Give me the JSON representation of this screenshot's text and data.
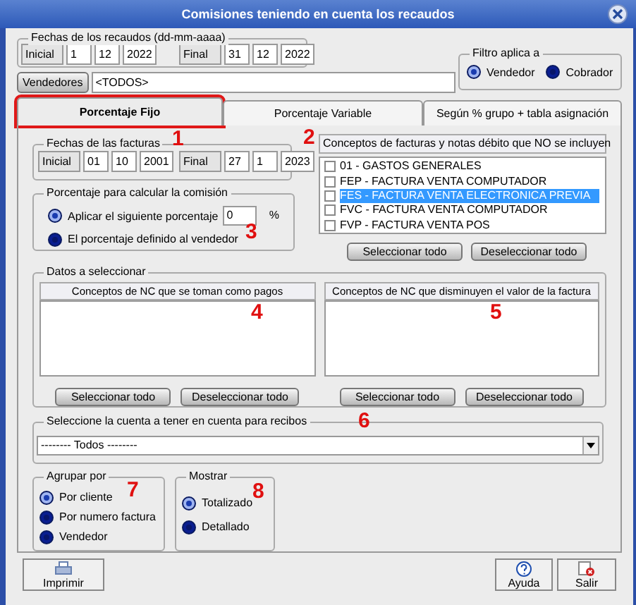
{
  "window": {
    "title": "Comisiones teniendo en cuenta los recaudos"
  },
  "fechas_recaudos": {
    "legend": "Fechas de los recaudos (dd-mm-aaaa)",
    "inicial": {
      "label": "Inicial",
      "day": "1",
      "month": "12",
      "year": "2022"
    },
    "final": {
      "label": "Final",
      "day": "31",
      "month": "12",
      "year": "2022"
    }
  },
  "vendedores": {
    "button": "Vendedores",
    "value": "<TODOS>"
  },
  "filtro": {
    "legend": "Filtro aplica a",
    "options": [
      {
        "label": "Vendedor",
        "selected": true
      },
      {
        "label": "Cobrador",
        "selected": false
      }
    ]
  },
  "tabs": [
    {
      "label": "Porcentaje Fijo",
      "selected": true,
      "highlighted": true
    },
    {
      "label": "Porcentaje Variable",
      "selected": false,
      "highlighted": false
    },
    {
      "label": "Según % grupo + tabla asignación",
      "selected": false,
      "highlighted": false
    }
  ],
  "fechas_facturas": {
    "legend": "Fechas de las facturas",
    "annotation": "1",
    "inicial": {
      "label": "Inicial",
      "day": "01",
      "month": "10",
      "year": "2001"
    },
    "final": {
      "label": "Final",
      "day": "27",
      "month": "1",
      "year": "2023"
    }
  },
  "conceptos": {
    "header": "Conceptos de facturas y notas débito que NO se incluyen",
    "annotation": "2",
    "items": [
      {
        "label": "01 - GASTOS GENERALES",
        "checked": false,
        "selected": false
      },
      {
        "label": "FEP - FACTURA VENTA COMPUTADOR",
        "checked": false,
        "selected": false
      },
      {
        "label": "FES - FACTURA VENTA ELECTRONICA PREVIA",
        "checked": false,
        "selected": true
      },
      {
        "label": "FVC - FACTURA VENTA COMPUTADOR",
        "checked": false,
        "selected": false
      },
      {
        "label": "FVP - FACTURA VENTA POS",
        "checked": false,
        "selected": false
      }
    ],
    "buttons": [
      "Seleccionar todo",
      "Deseleccionar todo"
    ]
  },
  "porcentaje": {
    "legend": "Porcentaje para calcular la comisión",
    "annotation": "3",
    "value": "0",
    "unit": "%",
    "options": [
      {
        "label": "Aplicar el siguiente porcentaje",
        "selected": true
      },
      {
        "label": "El porcentaje definido al vendedor",
        "selected": false
      }
    ]
  },
  "datos": {
    "legend": "Datos a seleccionar",
    "lists": [
      {
        "header": "Conceptos de NC que se toman como pagos",
        "annotation": "4",
        "buttons": [
          "Seleccionar todo",
          "Deseleccionar todo"
        ]
      },
      {
        "header": "Conceptos de NC que disminuyen el valor de la factura",
        "annotation": "5",
        "buttons": [
          "Seleccionar todo",
          "Deseleccionar todo"
        ]
      }
    ]
  },
  "cuenta": {
    "legend": "Seleccione la cuenta a tener en cuenta para recibos",
    "annotation": "6",
    "value": "-------- Todos --------"
  },
  "agrupar": {
    "legend": "Agrupar por",
    "annotation": "7",
    "options": [
      {
        "label": "Por cliente",
        "selected": true
      },
      {
        "label": "Por numero factura",
        "selected": false
      },
      {
        "label": "Vendedor",
        "selected": false
      }
    ]
  },
  "mostrar": {
    "legend": "Mostrar",
    "annotation": "8",
    "options": [
      {
        "label": "Totalizado",
        "selected": true
      },
      {
        "label": "Detallado",
        "selected": false
      }
    ]
  },
  "footer": {
    "print": "Imprimir",
    "help": "Ayuda",
    "exit": "Salir"
  }
}
